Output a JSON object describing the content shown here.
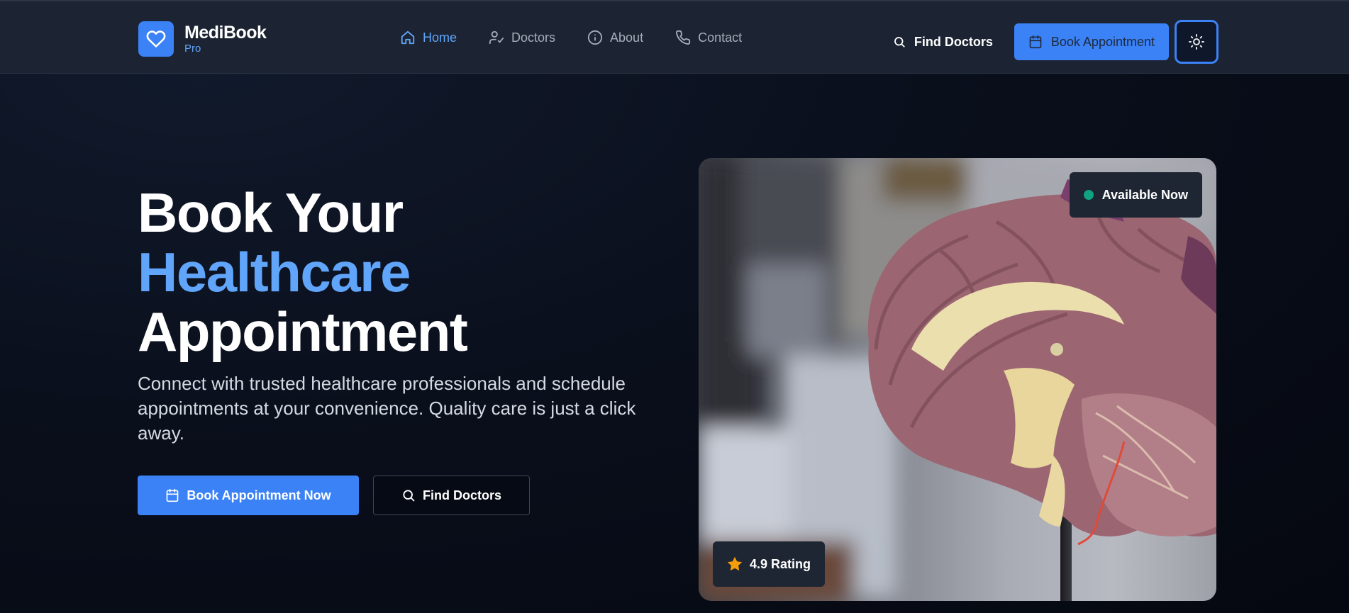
{
  "brand": {
    "name": "MediBook",
    "sub": "Pro"
  },
  "nav": {
    "links": [
      {
        "label": "Home",
        "icon": "home-icon",
        "active": true
      },
      {
        "label": "Doctors",
        "icon": "user-check-icon",
        "active": false
      },
      {
        "label": "About",
        "icon": "info-icon",
        "active": false
      },
      {
        "label": "Contact",
        "icon": "phone-icon",
        "active": false
      }
    ],
    "find_doctors": "Find Doctors",
    "book_appointment": "Book Appointment",
    "theme_toggle_icon": "sun-icon"
  },
  "hero": {
    "title_line1": "Book Your",
    "title_line2": "Healthcare",
    "title_line3": "Appointment",
    "description": "Connect with trusted healthcare professionals and schedule appointments at your convenience. Quality care is just a click away.",
    "primary_button": "Book Appointment Now",
    "secondary_button": "Find Doctors"
  },
  "image_card": {
    "subject": "brain-anatomy-model-photo",
    "available_badge": "Available Now",
    "rating_badge": "4.9 Rating"
  },
  "colors": {
    "accent": "#3b82f6",
    "accent_light": "#60a5fa",
    "status_available": "#10a37f",
    "star": "#f59e0b",
    "nav_bg": "#1c2433"
  }
}
